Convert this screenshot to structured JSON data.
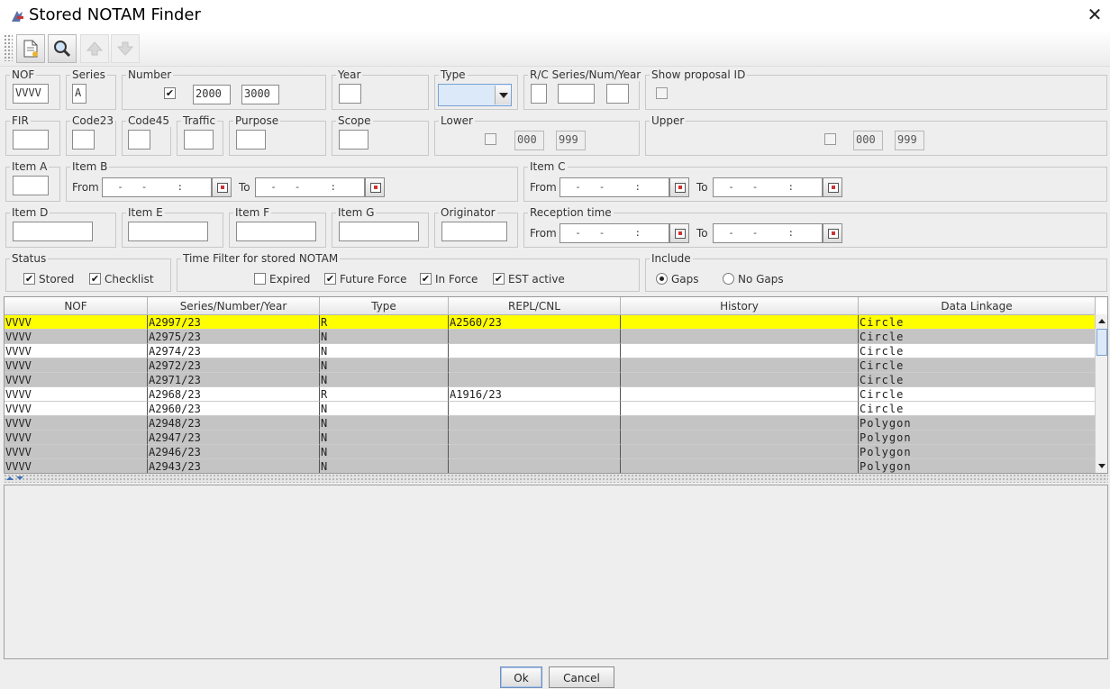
{
  "window": {
    "title": "Stored NOTAM Finder"
  },
  "toolbar": {
    "icons": [
      "new-document-icon",
      "search-icon",
      "arrow-up-icon",
      "arrow-down-icon"
    ]
  },
  "filters": {
    "nof": {
      "label": "NOF",
      "value": "VVVV"
    },
    "series": {
      "label": "Series",
      "value": "A"
    },
    "number": {
      "label": "Number",
      "checked": "✔",
      "from": "2000",
      "to": "3000"
    },
    "year": {
      "label": "Year",
      "value": ""
    },
    "type": {
      "label": "Type",
      "value": ""
    },
    "rc": {
      "label": "R/C Series/Num/Year"
    },
    "proposal": {
      "label": "Show proposal ID"
    },
    "fir": {
      "label": "FIR"
    },
    "code23": {
      "label": "Code23"
    },
    "code45": {
      "label": "Code45"
    },
    "traffic": {
      "label": "Traffic"
    },
    "purpose": {
      "label": "Purpose"
    },
    "scope": {
      "label": "Scope"
    },
    "lower": {
      "label": "Lower",
      "from": "000",
      "to": "999"
    },
    "upper": {
      "label": "Upper",
      "from": "000",
      "to": "999"
    },
    "itemA": {
      "label": "Item A"
    },
    "itemB": {
      "label": "Item B",
      "from_label": "From",
      "to_label": "To"
    },
    "itemC": {
      "label": "Item C",
      "from_label": "From",
      "to_label": "To"
    },
    "itemD": {
      "label": "Item D"
    },
    "itemE": {
      "label": "Item E"
    },
    "itemF": {
      "label": "Item F"
    },
    "itemG": {
      "label": "Item G"
    },
    "originator": {
      "label": "Originator"
    },
    "reception": {
      "label": "Reception time",
      "from_label": "From",
      "to_label": "To"
    },
    "date_mask": "  -   -     :",
    "status": {
      "label": "Status",
      "stored": "Stored",
      "checklist": "Checklist",
      "check": "✔"
    },
    "timefilter": {
      "label": "Time Filter for stored NOTAM",
      "expired": "Expired",
      "future": "Future Force",
      "inforce": "In Force",
      "est": "EST active",
      "check": "✔"
    },
    "include": {
      "label": "Include",
      "gaps": "Gaps",
      "nogaps": "No Gaps"
    }
  },
  "table": {
    "columns": [
      "NOF",
      "Series/Number/Year",
      "Type",
      "REPL/CNL",
      "History",
      "Data Linkage"
    ],
    "rows": [
      {
        "nof": "VVVV",
        "snum": "A2997/23",
        "type": "R",
        "repl": "A2560/23",
        "hist": "",
        "link": "Circle"
      },
      {
        "nof": "VVVV",
        "snum": "A2975/23",
        "type": "N",
        "repl": "",
        "hist": "",
        "link": "Circle"
      },
      {
        "nof": "VVVV",
        "snum": "A2974/23",
        "type": "N",
        "repl": "",
        "hist": "",
        "link": "Circle"
      },
      {
        "nof": "VVVV",
        "snum": "A2972/23",
        "type": "N",
        "repl": "",
        "hist": "",
        "link": "Circle"
      },
      {
        "nof": "VVVV",
        "snum": "A2971/23",
        "type": "N",
        "repl": "",
        "hist": "",
        "link": "Circle"
      },
      {
        "nof": "VVVV",
        "snum": "A2968/23",
        "type": "R",
        "repl": "A1916/23",
        "hist": "",
        "link": "Circle"
      },
      {
        "nof": "VVVV",
        "snum": "A2960/23",
        "type": "N",
        "repl": "",
        "hist": "",
        "link": "Circle"
      },
      {
        "nof": "VVVV",
        "snum": "A2948/23",
        "type": "N",
        "repl": "",
        "hist": "",
        "link": "Polygon"
      },
      {
        "nof": "VVVV",
        "snum": "A2947/23",
        "type": "N",
        "repl": "",
        "hist": "",
        "link": "Polygon"
      },
      {
        "nof": "VVVV",
        "snum": "A2946/23",
        "type": "N",
        "repl": "",
        "hist": "",
        "link": "Polygon"
      },
      {
        "nof": "VVVV",
        "snum": "A2943/23",
        "type": "N",
        "repl": "",
        "hist": "",
        "link": "Polygon"
      }
    ],
    "row_styles": [
      "selected",
      "gray",
      "white",
      "gray",
      "gray",
      "white",
      "white",
      "gray",
      "gray",
      "gray",
      "gray"
    ]
  },
  "colors": {
    "selected": "#ffff00",
    "gray": "#c4c4c4",
    "white": "#ffffff"
  },
  "buttons": {
    "ok": "Ok",
    "cancel": "Cancel"
  }
}
